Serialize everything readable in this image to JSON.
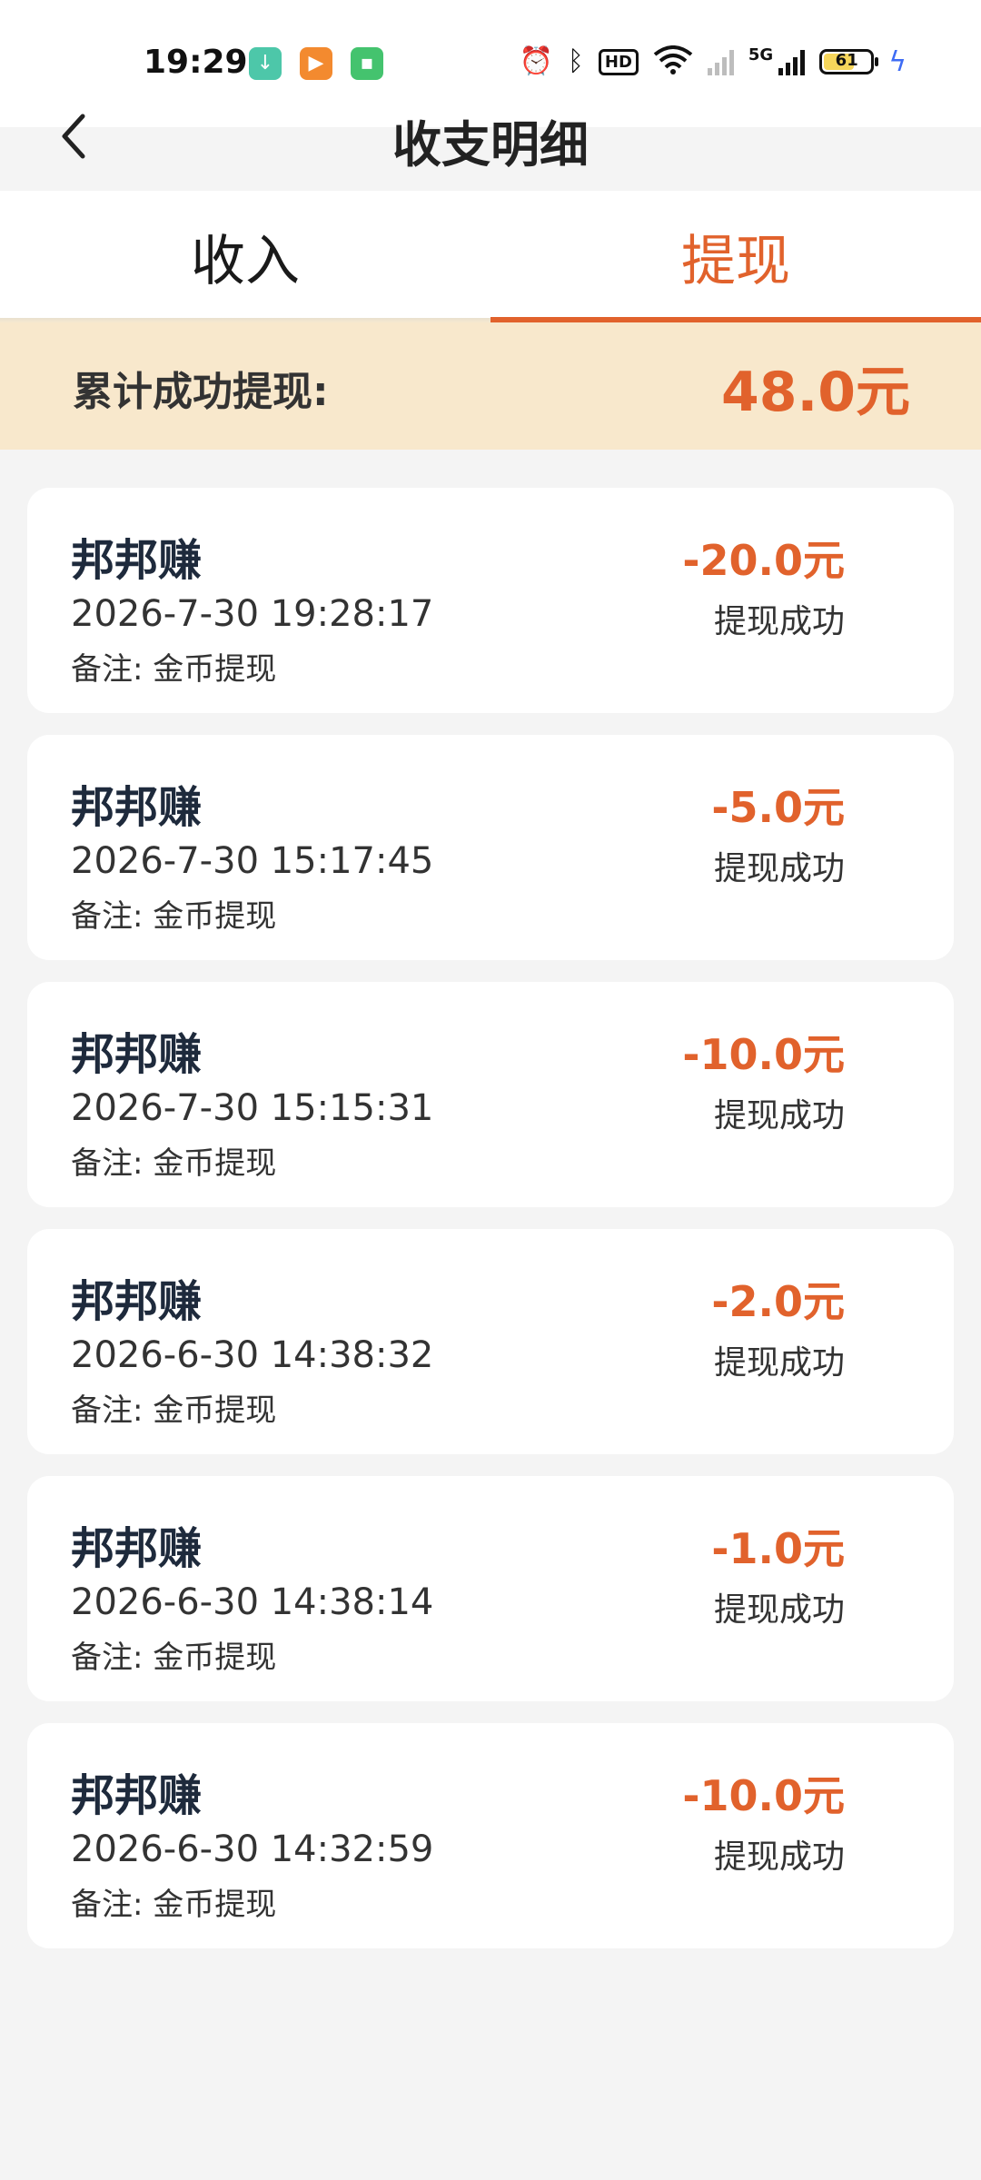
{
  "status_bar": {
    "time": "19:29",
    "battery_level": "61",
    "network": "5G",
    "hd_label": "HD",
    "icons": [
      "download-app-icon",
      "video-app-icon",
      "chat-app-icon",
      "alarm-icon",
      "bluetooth-icon",
      "hd-icon",
      "wifi-icon",
      "signal-icon",
      "battery-icon",
      "charging-icon"
    ]
  },
  "header": {
    "title": "收支明细"
  },
  "tabs": [
    {
      "label": "收入",
      "active": false
    },
    {
      "label": "提现",
      "active": true
    }
  ],
  "summary": {
    "label": "累计成功提现:",
    "amount": "48.0元"
  },
  "records": [
    {
      "title": "邦邦赚",
      "amount": "-20.0元",
      "time": "2026-7-30 19:28:17",
      "status": "提现成功",
      "note": "备注: 金币提现"
    },
    {
      "title": "邦邦赚",
      "amount": "-5.0元",
      "time": "2026-7-30 15:17:45",
      "status": "提现成功",
      "note": "备注: 金币提现"
    },
    {
      "title": "邦邦赚",
      "amount": "-10.0元",
      "time": "2026-7-30 15:15:31",
      "status": "提现成功",
      "note": "备注: 金币提现"
    },
    {
      "title": "邦邦赚",
      "amount": "-2.0元",
      "time": "2026-6-30 14:38:32",
      "status": "提现成功",
      "note": "备注: 金币提现"
    },
    {
      "title": "邦邦赚",
      "amount": "-1.0元",
      "time": "2026-6-30 14:38:14",
      "status": "提现成功",
      "note": "备注: 金币提现"
    },
    {
      "title": "邦邦赚",
      "amount": "-10.0元",
      "time": "2026-6-30 14:32:59",
      "status": "提现成功",
      "note": "备注: 金币提现"
    }
  ],
  "colors": {
    "accent": "#e1622c",
    "summary_bg": "#f8e8cc",
    "page_bg": "#f4f4f4"
  }
}
